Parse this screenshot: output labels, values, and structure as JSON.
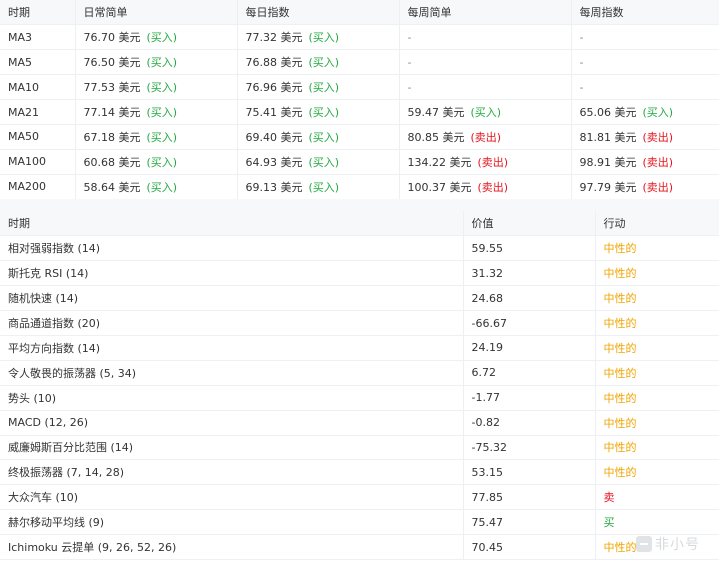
{
  "ma_table": {
    "headers": [
      "时期",
      "日常简单",
      "每日指数",
      "每周简单",
      "每周指数"
    ],
    "rows": [
      {
        "period": "MA3",
        "daily_simple": {
          "value": "76.70",
          "unit": "美元",
          "signal": "(买入)",
          "type": "buy"
        },
        "daily_exp": {
          "value": "77.32",
          "unit": "美元",
          "signal": "(买入)",
          "type": "buy"
        },
        "weekly_simple": {
          "value": "-",
          "unit": "",
          "signal": "",
          "type": "dash"
        },
        "weekly_exp": {
          "value": "-",
          "unit": "",
          "signal": "",
          "type": "dash"
        }
      },
      {
        "period": "MA5",
        "daily_simple": {
          "value": "76.50",
          "unit": "美元",
          "signal": "(买入)",
          "type": "buy"
        },
        "daily_exp": {
          "value": "76.88",
          "unit": "美元",
          "signal": "(买入)",
          "type": "buy"
        },
        "weekly_simple": {
          "value": "-",
          "unit": "",
          "signal": "",
          "type": "dash"
        },
        "weekly_exp": {
          "value": "-",
          "unit": "",
          "signal": "",
          "type": "dash"
        }
      },
      {
        "period": "MA10",
        "daily_simple": {
          "value": "77.53",
          "unit": "美元",
          "signal": "(买入)",
          "type": "buy"
        },
        "daily_exp": {
          "value": "76.96",
          "unit": "美元",
          "signal": "(买入)",
          "type": "buy"
        },
        "weekly_simple": {
          "value": "-",
          "unit": "",
          "signal": "",
          "type": "dash"
        },
        "weekly_exp": {
          "value": "-",
          "unit": "",
          "signal": "",
          "type": "dash"
        }
      },
      {
        "period": "MA21",
        "daily_simple": {
          "value": "77.14",
          "unit": "美元",
          "signal": "(买入)",
          "type": "buy"
        },
        "daily_exp": {
          "value": "75.41",
          "unit": "美元",
          "signal": "(买入)",
          "type": "buy"
        },
        "weekly_simple": {
          "value": "59.47",
          "unit": "美元",
          "signal": "(买入)",
          "type": "buy"
        },
        "weekly_exp": {
          "value": "65.06",
          "unit": "美元",
          "signal": "(买入)",
          "type": "buy"
        }
      },
      {
        "period": "MA50",
        "daily_simple": {
          "value": "67.18",
          "unit": "美元",
          "signal": "(买入)",
          "type": "buy"
        },
        "daily_exp": {
          "value": "69.40",
          "unit": "美元",
          "signal": "(买入)",
          "type": "buy"
        },
        "weekly_simple": {
          "value": "80.85",
          "unit": "美元",
          "signal": "(卖出)",
          "type": "sell"
        },
        "weekly_exp": {
          "value": "81.81",
          "unit": "美元",
          "signal": "(卖出)",
          "type": "sell"
        }
      },
      {
        "period": "MA100",
        "daily_simple": {
          "value": "60.68",
          "unit": "美元",
          "signal": "(买入)",
          "type": "buy"
        },
        "daily_exp": {
          "value": "64.93",
          "unit": "美元",
          "signal": "(买入)",
          "type": "buy"
        },
        "weekly_simple": {
          "value": "134.22",
          "unit": "美元",
          "signal": "(卖出)",
          "type": "sell"
        },
        "weekly_exp": {
          "value": "98.91",
          "unit": "美元",
          "signal": "(卖出)",
          "type": "sell"
        }
      },
      {
        "period": "MA200",
        "daily_simple": {
          "value": "58.64",
          "unit": "美元",
          "signal": "(买入)",
          "type": "buy"
        },
        "daily_exp": {
          "value": "69.13",
          "unit": "美元",
          "signal": "(买入)",
          "type": "buy"
        },
        "weekly_simple": {
          "value": "100.37",
          "unit": "美元",
          "signal": "(卖出)",
          "type": "sell"
        },
        "weekly_exp": {
          "value": "97.79",
          "unit": "美元",
          "signal": "(卖出)",
          "type": "sell"
        }
      }
    ]
  },
  "indicator_table": {
    "headers": [
      "时期",
      "价值",
      "行动"
    ],
    "rows": [
      {
        "name": "相对强弱指数 (14)",
        "value": "59.55",
        "action": "中性的",
        "type": "neutral"
      },
      {
        "name": "斯托克 RSI (14)",
        "value": "31.32",
        "action": "中性的",
        "type": "neutral"
      },
      {
        "name": "随机快速 (14)",
        "value": "24.68",
        "action": "中性的",
        "type": "neutral"
      },
      {
        "name": "商品通道指数 (20)",
        "value": "-66.67",
        "action": "中性的",
        "type": "neutral"
      },
      {
        "name": "平均方向指数 (14)",
        "value": "24.19",
        "action": "中性的",
        "type": "neutral"
      },
      {
        "name": "令人敬畏的振荡器 (5, 34)",
        "value": "6.72",
        "action": "中性的",
        "type": "neutral"
      },
      {
        "name": "势头 (10)",
        "value": "-1.77",
        "action": "中性的",
        "type": "neutral"
      },
      {
        "name": "MACD (12, 26)",
        "value": "-0.82",
        "action": "中性的",
        "type": "neutral"
      },
      {
        "name": "威廉姆斯百分比范围 (14)",
        "value": "-75.32",
        "action": "中性的",
        "type": "neutral"
      },
      {
        "name": "终极振荡器 (7, 14, 28)",
        "value": "53.15",
        "action": "中性的",
        "type": "neutral"
      },
      {
        "name": "大众汽车 (10)",
        "value": "77.85",
        "action": "卖",
        "type": "sell"
      },
      {
        "name": "赫尔移动平均线 (9)",
        "value": "75.47",
        "action": "买",
        "type": "buy"
      },
      {
        "name": "Ichimoku 云提单 (9, 26, 52, 26)",
        "value": "70.45",
        "action": "中性的",
        "type": "neutral"
      }
    ]
  },
  "watermark": {
    "text": "非小号",
    "icon": "exchange-logo-icon"
  },
  "colors": {
    "buy": "#22a93f",
    "sell": "#e5141e",
    "neutral": "#f0a400",
    "header_bg": "#f6f8fa"
  }
}
